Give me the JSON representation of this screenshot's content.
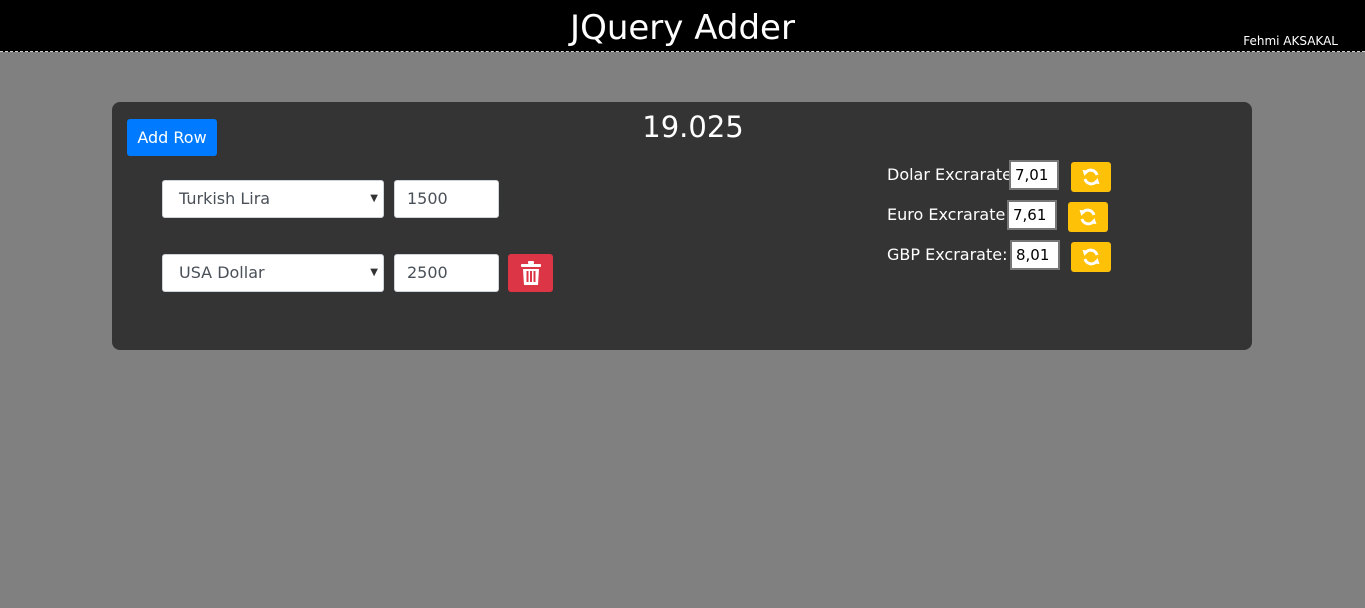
{
  "header": {
    "title": "JQuery Adder",
    "author": "Fehmi AKSAKAL"
  },
  "panel": {
    "add_row_label": "Add Row",
    "total": "19.025",
    "rows": [
      {
        "currency": "Turkish Lira",
        "amount": "1500",
        "deletable": false
      },
      {
        "currency": "USA Dollar",
        "amount": "2500",
        "deletable": true
      }
    ],
    "rates": [
      {
        "label": "Dolar Excrarate:",
        "value": "7,01"
      },
      {
        "label": "Euro Excrarate:",
        "value": "7,61"
      },
      {
        "label": "GBP Excrarate:",
        "value": "8,01"
      }
    ]
  },
  "colors": {
    "background": "#808080",
    "header": "#000000",
    "panel": "#343434",
    "primary": "#007bff",
    "danger": "#dc3545",
    "warning": "#ffc107"
  },
  "icons": {
    "delete": "trash-icon",
    "refresh": "refresh-icon",
    "dropdown": "caret-down-icon"
  }
}
